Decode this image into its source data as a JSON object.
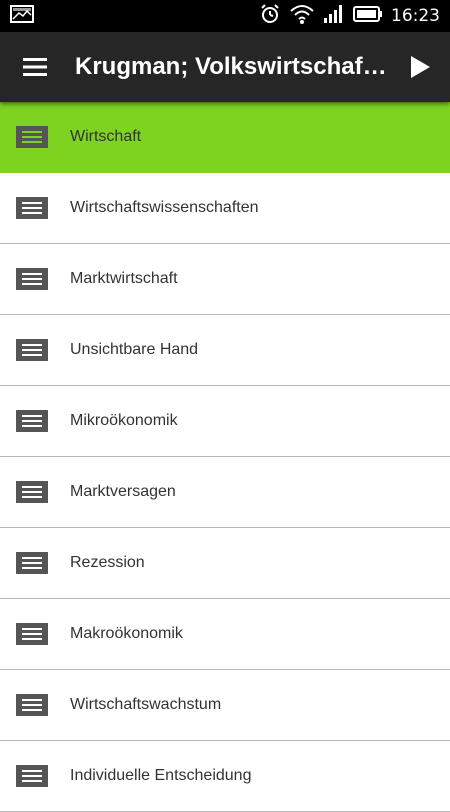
{
  "status_bar": {
    "time": "16:23",
    "icons": [
      "gallery-icon",
      "alarm-icon",
      "wifi-icon",
      "signal-icon",
      "battery-icon"
    ]
  },
  "app_bar": {
    "title": "Krugman; Volkswirtschaft…",
    "menu_icon": "hamburger-menu-icon",
    "play_icon": "play-icon"
  },
  "colors": {
    "accent": "#7ed321",
    "app_bar": "#262626",
    "status_bar": "#000000",
    "item_icon": "#555555",
    "divider": "#b8b8b8"
  },
  "list": {
    "selected_index": 0,
    "items": [
      {
        "label": "Wirtschaft"
      },
      {
        "label": "Wirtschaftswissenschaften"
      },
      {
        "label": "Marktwirtschaft"
      },
      {
        "label": "Unsichtbare Hand"
      },
      {
        "label": "Mikroökonomik"
      },
      {
        "label": "Marktversagen"
      },
      {
        "label": "Rezession"
      },
      {
        "label": "Makroökonomik"
      },
      {
        "label": "Wirtschaftswachstum"
      },
      {
        "label": "Individuelle Entscheidung"
      }
    ]
  }
}
